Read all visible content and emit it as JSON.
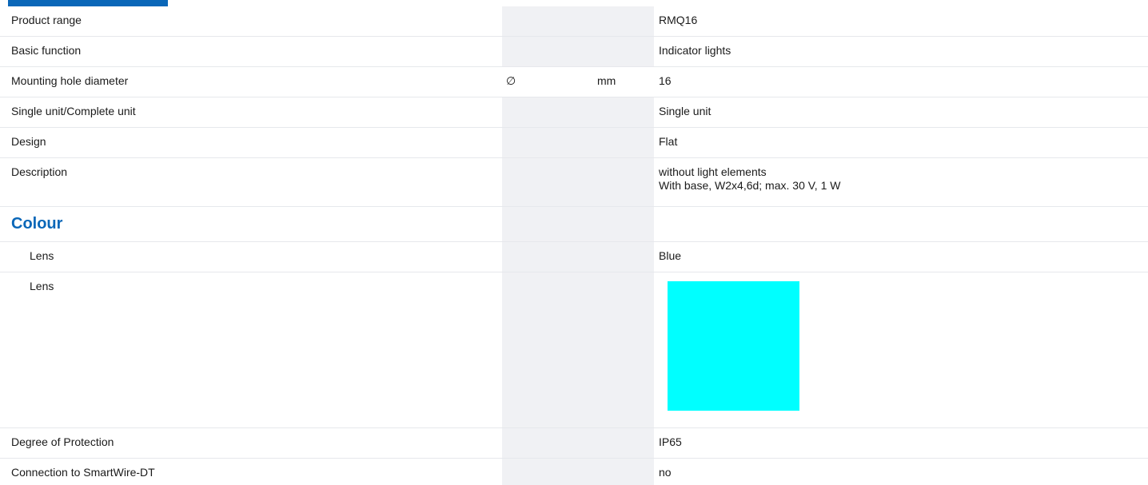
{
  "section_colour": "Colour",
  "rows": [
    {
      "label": "Product range",
      "value": "RMQ16"
    },
    {
      "label": "Basic function",
      "value": "Indicator lights"
    },
    {
      "label": "Mounting hole diameter",
      "symbol": "∅",
      "unit": "mm",
      "value": "16"
    },
    {
      "label": "Single unit/Complete unit",
      "value": "Single unit"
    },
    {
      "label": "Design",
      "value": "Flat"
    },
    {
      "label": "Description",
      "value_line1": "without light elements",
      "value_line2": "With base, W2x4,6d; max. 30 V, 1 W"
    }
  ],
  "colour_rows": [
    {
      "label": "Lens",
      "value": "Blue"
    },
    {
      "label": "Lens",
      "swatch_color": "#00ffff"
    }
  ],
  "tail_rows": [
    {
      "label": "Degree of Protection",
      "value": "IP65"
    },
    {
      "label": "Connection to SmartWire-DT",
      "value": "no"
    }
  ]
}
